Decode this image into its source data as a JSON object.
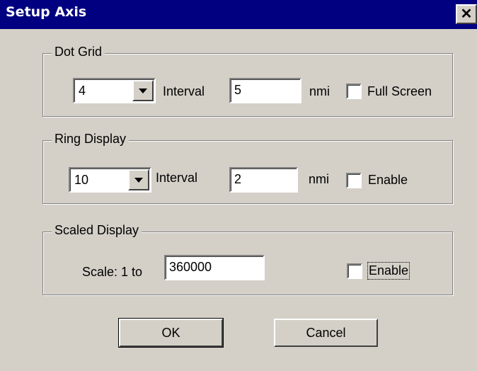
{
  "window": {
    "title": "Setup Axis",
    "close_label": "✕"
  },
  "dot_grid": {
    "legend": "Dot Grid",
    "combo_value": "4",
    "interval_label": "Interval",
    "interval_value": "5",
    "unit": "nmi",
    "checkbox_label": "Full Screen",
    "checked": false
  },
  "ring_display": {
    "legend": "Ring Display",
    "combo_value": "10",
    "interval_label": "Interval",
    "interval_value": "2",
    "unit": "nmi",
    "checkbox_label": "Enable",
    "checked": false
  },
  "scaled_display": {
    "legend": "Scaled Display",
    "scale_label": "Scale: 1 to",
    "scale_value": "360000",
    "checkbox_label": "Enable",
    "checked": false
  },
  "buttons": {
    "ok": "OK",
    "cancel": "Cancel"
  }
}
